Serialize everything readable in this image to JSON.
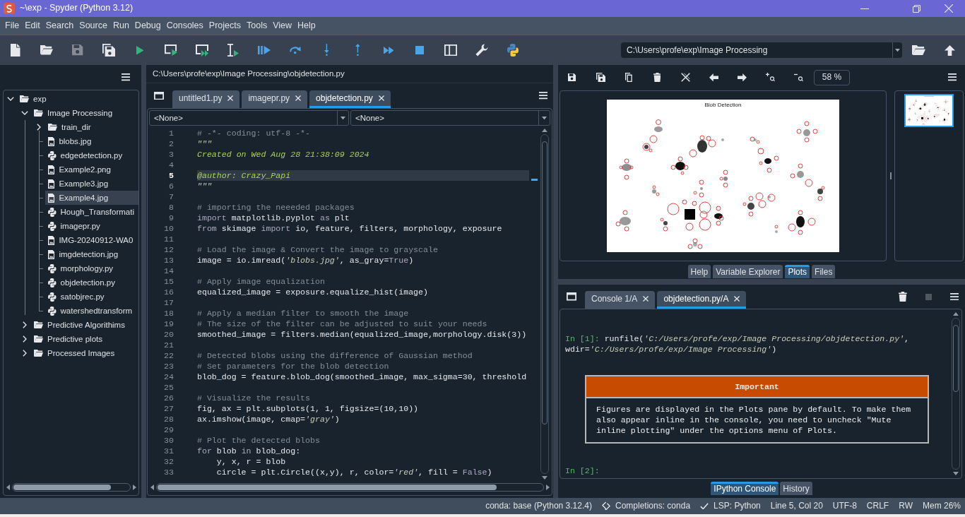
{
  "window": {
    "title": "~\\exp - Spyder (Python 3.12)"
  },
  "menu": [
    "File",
    "Edit",
    "Search",
    "Source",
    "Run",
    "Debug",
    "Consoles",
    "Projects",
    "Tools",
    "View",
    "Help"
  ],
  "toolbar": [
    {
      "kind": "new",
      "disabled": false
    },
    {
      "kind": "open",
      "disabled": false
    },
    {
      "kind": "save",
      "disabled": true
    },
    {
      "kind": "saveall",
      "disabled": false
    },
    {
      "kind": "run",
      "disabled": false
    },
    {
      "kind": "runcell",
      "disabled": false
    },
    {
      "kind": "runadvance",
      "disabled": false
    },
    {
      "kind": "runselection",
      "disabled": false
    },
    {
      "kind": "debug",
      "disabled": false
    },
    {
      "kind": "step",
      "disabled": false
    },
    {
      "kind": "stepin",
      "disabled": false
    },
    {
      "kind": "stepout",
      "disabled": false
    },
    {
      "kind": "continue",
      "disabled": false
    },
    {
      "kind": "stop",
      "disabled": false
    },
    {
      "kind": "maximize",
      "disabled": false
    },
    {
      "kind": "preferences",
      "disabled": false
    },
    {
      "kind": "pythonpath",
      "disabled": false
    }
  ],
  "working_directory": "C:\\Users\\profe\\exp\\Image Processing",
  "files": {
    "tree": [
      {
        "label": "exp",
        "kind": "folder",
        "expanded": true,
        "selected": false,
        "children": [
          {
            "label": "Image Processing",
            "kind": "folder",
            "expanded": true,
            "selected": false,
            "children": [
              {
                "label": "train_dir",
                "kind": "folder",
                "expanded": false,
                "selected": false
              },
              {
                "label": "blobs.jpg",
                "kind": "image",
                "selected": false
              },
              {
                "label": "edgedetection.py",
                "kind": "python",
                "selected": false
              },
              {
                "label": "Example2.png",
                "kind": "image",
                "selected": false
              },
              {
                "label": "Example3.jpg",
                "kind": "image",
                "selected": false
              },
              {
                "label": "Example4.jpg",
                "kind": "image",
                "selected": true
              },
              {
                "label": "Hough_Transformati",
                "kind": "python",
                "selected": false
              },
              {
                "label": "imagepr.py",
                "kind": "python",
                "selected": false
              },
              {
                "label": "IMG-20240912-WA0",
                "kind": "image",
                "selected": false
              },
              {
                "label": "imgdetection.jpg",
                "kind": "image",
                "selected": false
              },
              {
                "label": "morphology.py",
                "kind": "python",
                "selected": false
              },
              {
                "label": "objdetection.py",
                "kind": "python",
                "selected": false
              },
              {
                "label": "satobjrec.py",
                "kind": "python",
                "selected": false
              },
              {
                "label": "watershedtransform",
                "kind": "python",
                "selected": false
              }
            ]
          },
          {
            "label": "Predictive Algorithims",
            "kind": "folder",
            "expanded": false,
            "selected": false
          },
          {
            "label": "Predictive plots",
            "kind": "folder",
            "expanded": false,
            "selected": false
          },
          {
            "label": "Processed Images",
            "kind": "folder",
            "expanded": false,
            "selected": false
          }
        ]
      }
    ]
  },
  "editor": {
    "path": "C:\\Users\\profe\\exp\\Image Processing\\objdetection.py",
    "tabs": [
      {
        "label": "untitled1.py",
        "selected": false
      },
      {
        "label": "imagepr.py",
        "selected": false
      },
      {
        "label": "objdetection.py",
        "selected": true
      }
    ],
    "selectors": [
      {
        "value": "<None>"
      },
      {
        "value": "<None>"
      }
    ],
    "lines": [
      {
        "number": "1",
        "current": false,
        "tokens": [
          {
            "kind": "comment",
            "text": "# -*- coding: utf-8 -*-"
          }
        ]
      },
      {
        "number": "2",
        "current": false,
        "tokens": [
          {
            "kind": "string",
            "text": "\"\"\""
          }
        ]
      },
      {
        "number": "3",
        "current": false,
        "tokens": [
          {
            "kind": "docstring",
            "text": "Created on Wed Aug 28 21:38:09 2024"
          }
        ]
      },
      {
        "number": "4",
        "current": false
      },
      {
        "number": "5",
        "current": true,
        "tokens": [
          {
            "kind": "docstring",
            "text": "@author: Crazy_Papi"
          }
        ]
      },
      {
        "number": "6",
        "current": false,
        "tokens": [
          {
            "kind": "string",
            "text": "\"\"\""
          }
        ]
      },
      {
        "number": "7",
        "current": false
      },
      {
        "number": "8",
        "current": false,
        "tokens": [
          {
            "kind": "comment",
            "text": "# importing the neeeded packages"
          }
        ]
      },
      {
        "number": "9",
        "current": false,
        "tokens": [
          {
            "kind": "keyword",
            "text": "import"
          },
          {
            "kind": "plain",
            "text": " matplotlib.pyplot "
          },
          {
            "kind": "keyword",
            "text": "as"
          },
          {
            "kind": "plain",
            "text": " plt"
          }
        ]
      },
      {
        "number": "10",
        "current": false,
        "tokens": [
          {
            "kind": "keyword",
            "text": "from"
          },
          {
            "kind": "plain",
            "text": " skimage "
          },
          {
            "kind": "keyword",
            "text": "import"
          },
          {
            "kind": "plain",
            "text": " io, feature, filters, morphology, exposure"
          }
        ]
      },
      {
        "number": "11",
        "current": false
      },
      {
        "number": "12",
        "current": false,
        "tokens": [
          {
            "kind": "comment",
            "text": "# Load the image & Convert the image to grayscale"
          }
        ]
      },
      {
        "number": "13",
        "current": false,
        "tokens": [
          {
            "kind": "plain",
            "text": "image = io.imread("
          },
          {
            "kind": "string",
            "text": "'blobs.jpg'"
          },
          {
            "kind": "plain",
            "text": ", as_gray="
          },
          {
            "kind": "keyword",
            "text": "True"
          },
          {
            "kind": "plain",
            "text": ")"
          }
        ]
      },
      {
        "number": "14",
        "current": false
      },
      {
        "number": "15",
        "current": false,
        "tokens": [
          {
            "kind": "comment",
            "text": "# Apply image equalization"
          }
        ]
      },
      {
        "number": "16",
        "current": false,
        "tokens": [
          {
            "kind": "plain",
            "text": "equalized_image = exposure.equalize_hist(image)"
          }
        ]
      },
      {
        "number": "17",
        "current": false
      },
      {
        "number": "18",
        "current": false,
        "tokens": [
          {
            "kind": "comment",
            "text": "# Apply a median filter to smooth the image"
          }
        ]
      },
      {
        "number": "19",
        "current": false,
        "tokens": [
          {
            "kind": "comment",
            "text": "# The size of the filter can be adjusted to suit your needs"
          }
        ]
      },
      {
        "number": "20",
        "current": false,
        "tokens": [
          {
            "kind": "plain",
            "text": "smoothed_image = filters.median(equalized_image,morphology.disk(3))"
          }
        ]
      },
      {
        "number": "21",
        "current": false
      },
      {
        "number": "22",
        "current": false,
        "tokens": [
          {
            "kind": "comment",
            "text": "# Detected blobs using the difference of Gaussian method"
          }
        ]
      },
      {
        "number": "23",
        "current": false,
        "tokens": [
          {
            "kind": "comment",
            "text": "# Set parameters for the blob detection"
          }
        ]
      },
      {
        "number": "24",
        "current": false,
        "tokens": [
          {
            "kind": "plain",
            "text": "blob_dog = feature.blob_dog(smoothed_image, max_sigma=30, threshold"
          }
        ]
      },
      {
        "number": "25",
        "current": false
      },
      {
        "number": "26",
        "current": false,
        "tokens": [
          {
            "kind": "comment",
            "text": "# Visualize the results"
          }
        ]
      },
      {
        "number": "27",
        "current": false,
        "tokens": [
          {
            "kind": "plain",
            "text": "fig, ax = plt.subplots(1, 1, figsize=(10,10))"
          }
        ]
      },
      {
        "number": "28",
        "current": false,
        "tokens": [
          {
            "kind": "plain",
            "text": "ax.imshow(image, cmap="
          },
          {
            "kind": "string",
            "text": "'gray'"
          },
          {
            "kind": "plain",
            "text": ")"
          }
        ]
      },
      {
        "number": "29",
        "current": false
      },
      {
        "number": "30",
        "current": false,
        "tokens": [
          {
            "kind": "comment",
            "text": "# Plot the detected blobs"
          }
        ]
      },
      {
        "number": "31",
        "current": false,
        "tokens": [
          {
            "kind": "keyword",
            "text": "for"
          },
          {
            "kind": "plain",
            "text": " blob "
          },
          {
            "kind": "keyword",
            "text": "in"
          },
          {
            "kind": "plain",
            "text": " blob_dog:"
          }
        ]
      },
      {
        "number": "32",
        "current": false,
        "tokens": [
          {
            "kind": "plain",
            "text": "    y, x, r = blob"
          }
        ]
      },
      {
        "number": "33",
        "current": false,
        "tokens": [
          {
            "kind": "plain",
            "text": "    circle = plt.Circle((x,y), r, color="
          },
          {
            "kind": "string",
            "text": "'red'"
          },
          {
            "kind": "plain",
            "text": ", fill = "
          },
          {
            "kind": "keyword",
            "text": "False"
          },
          {
            "kind": "plain",
            "text": ")"
          }
        ]
      }
    ]
  },
  "plots": {
    "toolbar": [
      {
        "kind": "save",
        "disabled": false
      },
      {
        "kind": "saveall",
        "disabled": false
      },
      {
        "kind": "copy",
        "disabled": false
      },
      {
        "kind": "delete",
        "disabled": false
      },
      {
        "kind": "closeall",
        "disabled": false
      },
      {
        "kind": "back",
        "disabled": false
      },
      {
        "kind": "forward",
        "disabled": false
      },
      {
        "kind": "zoomin",
        "disabled": false
      },
      {
        "kind": "zoomout",
        "disabled": false
      }
    ],
    "zoom": "58 %",
    "figure_title": "Blob Detection",
    "thumbnails": [
      {
        "selected": true
      }
    ],
    "dock_tabs": [
      {
        "label": "Help",
        "selected": false
      },
      {
        "label": "Variable Explorer",
        "selected": false
      },
      {
        "label": "Plots",
        "selected": true
      },
      {
        "label": "Files",
        "selected": false
      }
    ]
  },
  "console": {
    "tabs": [
      {
        "label": "Console 1/A",
        "selected": false
      },
      {
        "label": "objdetection.py/A",
        "selected": true
      }
    ],
    "toolbar": [
      {
        "kind": "clear",
        "disabled": false
      },
      {
        "kind": "stop",
        "disabled": true
      }
    ],
    "output": [
      {
        "tokens": [
          {
            "kind": "prompt",
            "text": "In [1]:"
          },
          {
            "kind": "plain",
            "text": " runfile("
          },
          {
            "kind": "string",
            "text": "'C:/Users/profe/exp/Image Processing/objdetection.py'"
          },
          {
            "kind": "plain",
            "text": ","
          }
        ]
      },
      {
        "tokens": [
          {
            "kind": "plain",
            "text": "wdir="
          },
          {
            "kind": "string",
            "text": "'C:/Users/profe/exp/Image Processing'"
          },
          {
            "kind": "plain",
            "text": ")"
          }
        ]
      }
    ],
    "notice": {
      "title": "Important",
      "text": "Figures are displayed in the Plots pane by default. To make them also appear inline in the console, you need to uncheck \"Mute inline plotting\" under the options menu of Plots."
    },
    "prompt": "In [2]:",
    "dock_tabs": [
      {
        "label": "IPython Console",
        "selected": true
      },
      {
        "label": "History",
        "selected": false
      }
    ]
  },
  "status_bar": {
    "environment": "conda: base (Python 3.12.4)",
    "completions": "Completions: conda",
    "lsp": "LSP: Python",
    "cursor": "Line 5, Col 20",
    "encoding": "UTF-8",
    "line_endings": "CRLF",
    "permissions": "RW",
    "memory": "Mem 26%"
  }
}
